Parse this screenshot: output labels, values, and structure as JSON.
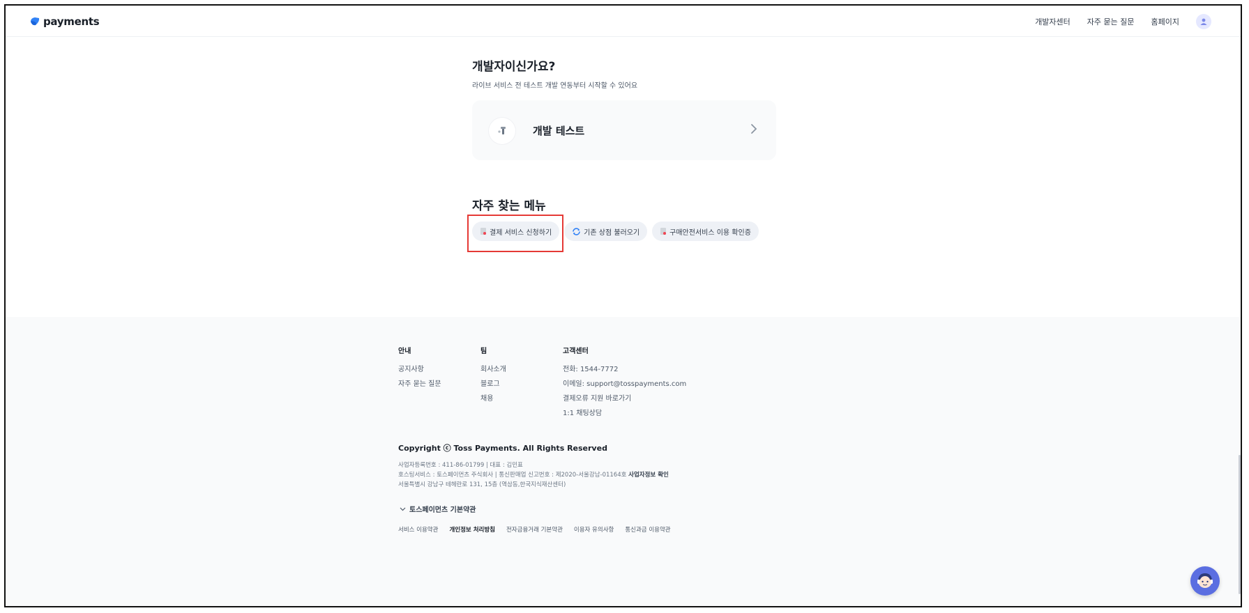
{
  "header": {
    "logo_text": "payments",
    "nav": [
      "개발자센터",
      "자주 묻는 질문",
      "홈페이지"
    ]
  },
  "developer": {
    "title": "개발자이신가요?",
    "subtitle": "라이브 서비스 전 테스트 개발 연동부터 시작할 수 있어요",
    "card_label": "개발 테스트"
  },
  "menu": {
    "title": "자주 찾는 메뉴",
    "chips": [
      {
        "label": "결제 서비스 신청하기",
        "icon": "document-icon"
      },
      {
        "label": "기존 상점 불러오기",
        "icon": "refresh-icon"
      },
      {
        "label": "구매안전서비스 이용 확인증",
        "icon": "document-icon"
      }
    ]
  },
  "footer": {
    "columns": [
      {
        "title": "안내",
        "links": [
          "공지사항",
          "자주 묻는 질문"
        ]
      },
      {
        "title": "팀",
        "links": [
          "회사소개",
          "블로그",
          "채용"
        ]
      },
      {
        "title": "고객센터",
        "links": [
          "전화: 1544-7772",
          "이메일: support@tosspayments.com",
          "결제오류 지원 바로가기",
          "1:1 채팅상담"
        ]
      }
    ],
    "copyright": "Copyright ⓒ Toss Payments. All Rights Reserved",
    "legal": {
      "line1": "사업자등록번호 : 411-86-01799 | 대표 : 김민표",
      "line2": "호스팅서비스 : 토스페이먼츠 주식회사 | 통신판매업 신고번호 : 제2020-서울강남-01164호",
      "line2_link": "사업자정보 확인",
      "line3": "서울특별시 강남구 테헤란로 131, 15층 (역삼동,한국지식재산센터)"
    },
    "terms_toggle": "토스페이먼츠 기본약관",
    "terms": [
      "서비스 이용약관",
      "개인정보 처리방침",
      "전자금융거래 기본약관",
      "이용자 유의사항",
      "통신과금 이용약관"
    ]
  },
  "colors": {
    "brand": "#3182f6",
    "highlight": "#e53935",
    "chip_bg": "#eef1f6"
  }
}
